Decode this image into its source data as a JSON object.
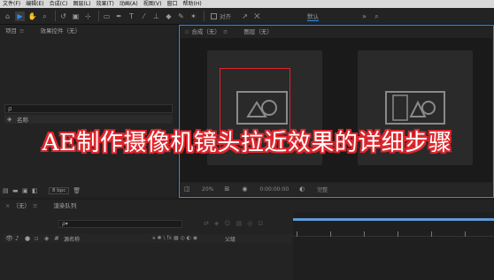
{
  "menubar": {
    "items": [
      "文件(F)",
      "编辑(E)",
      "合成(C)",
      "图层(L)",
      "效果(T)",
      "动画(A)",
      "视图(V)",
      "窗口",
      "帮助(H)"
    ]
  },
  "toolbar": {
    "align_label": "对齐",
    "workspace_label": "默认"
  },
  "project_panel": {
    "tabs": [
      "项目",
      "效果控件（无）"
    ],
    "header_name": "名称",
    "bpc": "8 bpc"
  },
  "composition_panel": {
    "tabs": [
      "合成（无）",
      "图层（无）"
    ],
    "footer_zoom": "20%",
    "footer_time": "0:00:00:00",
    "footer_mode": "完整"
  },
  "timeline_panel": {
    "tabs": [
      "（无）",
      "渲染队列"
    ],
    "search_placeholder": "ρ▾",
    "col_source": "源名称",
    "col_parent": "父级"
  },
  "overlay_title": "AE制作摄像机镜头拉近效果的详细步骤",
  "colors": {
    "accent": "#2d8ceb",
    "title_stroke": "#e0262c",
    "title_fill": "#ffffff"
  }
}
